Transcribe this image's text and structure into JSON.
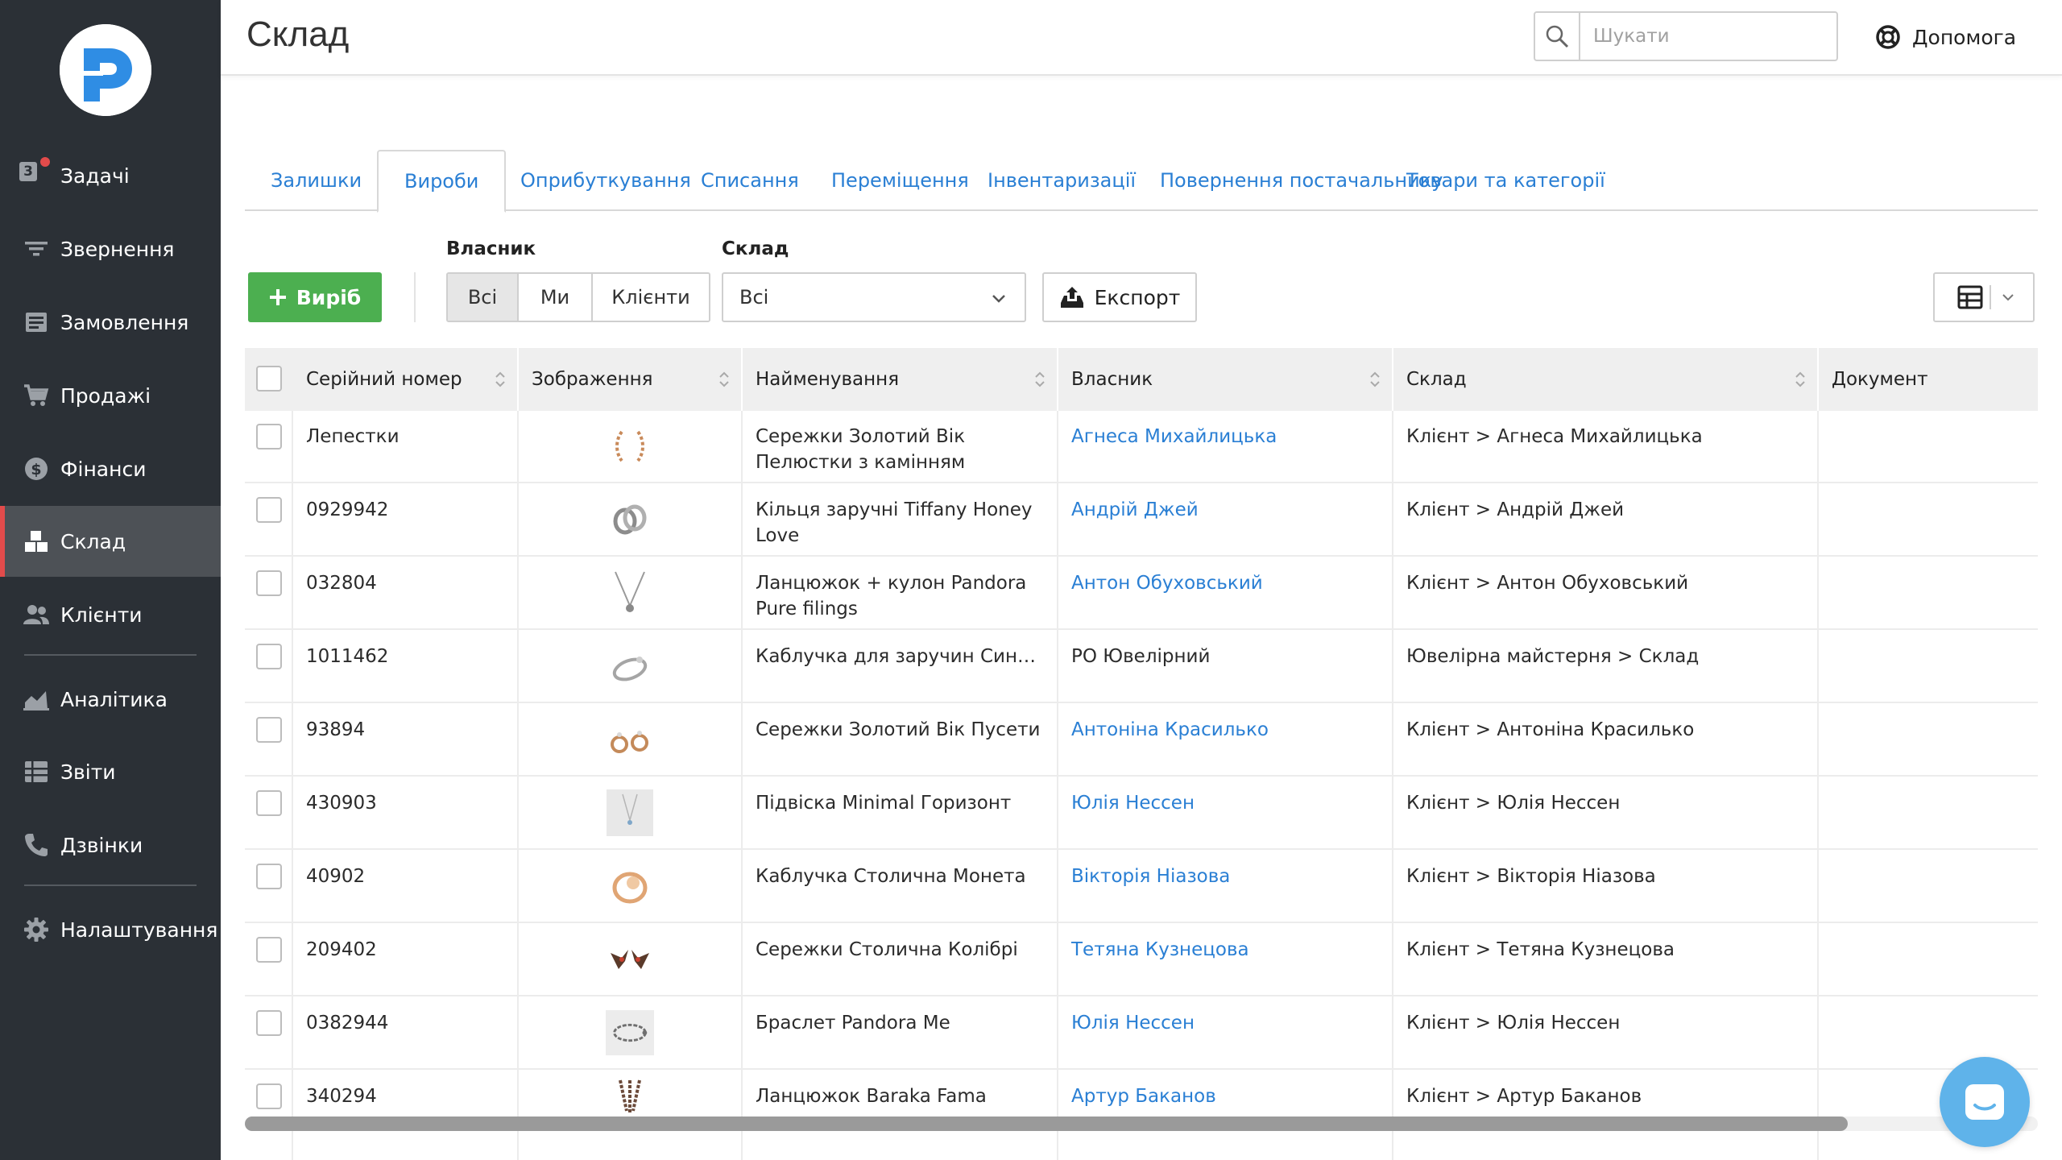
{
  "app": {
    "title": "Склад"
  },
  "sidebar": {
    "task_badge": "3",
    "items": [
      {
        "label": "Задачі"
      },
      {
        "label": "Звернення"
      },
      {
        "label": "Замовлення"
      },
      {
        "label": "Продажі"
      },
      {
        "label": "Фінанси"
      },
      {
        "label": "Склад"
      },
      {
        "label": "Клієнти"
      },
      {
        "label": "Аналітика"
      },
      {
        "label": "Звіти"
      },
      {
        "label": "Дзвінки"
      },
      {
        "label": "Налаштування"
      }
    ]
  },
  "header": {
    "search_placeholder": "Шукати",
    "help_label": "Допомога"
  },
  "tabs": [
    {
      "label": "Залишки"
    },
    {
      "label": "Вироби"
    },
    {
      "label": "Оприбуткування"
    },
    {
      "label": "Списання"
    },
    {
      "label": "Переміщення"
    },
    {
      "label": "Інвентаризації"
    },
    {
      "label": "Повернення постачальнику"
    },
    {
      "label": "Товари та категорії"
    }
  ],
  "toolbar": {
    "add_label": "Виріб",
    "owner_label": "Власник",
    "owner_options": [
      "Всі",
      "Ми",
      "Клієнти"
    ],
    "warehouse_label": "Склад",
    "warehouse_value": "Всі",
    "export_label": "Експорт"
  },
  "table": {
    "columns": [
      "Серійний номер",
      "Зображення",
      "Найменування",
      "Власник",
      "Склад",
      "Документ"
    ],
    "rows": [
      {
        "serial": "Лепестки",
        "name": "Сережки Золотий Вік Пелюстки з камінням",
        "owner": "Агнеса Михайлицька",
        "warehouse": "Клієнт > Агнеса Михайлицька",
        "document": ""
      },
      {
        "serial": "0929942",
        "name": "Кільця заручні Tiffany Honey Love",
        "owner": "Андрій Джей",
        "warehouse": "Клієнт > Андрій Джей",
        "document": ""
      },
      {
        "serial": "032804",
        "name": "Ланцюжок + кулон Pandora Pure filings",
        "owner": "Антон Обуховський",
        "warehouse": "Клієнт > Антон Обуховський",
        "document": ""
      },
      {
        "serial": "1011462",
        "name": "Каблучка для заручин Синевир l...",
        "owner": "PO Ювелірний",
        "warehouse": "Ювелірна майстерня > Склад",
        "document": ""
      },
      {
        "serial": "93894",
        "name": "Сережки Золотий Вік Пусети",
        "owner": "Антоніна Красилько",
        "warehouse": "Клієнт > Антоніна Красилько",
        "document": ""
      },
      {
        "serial": "430903",
        "name": "Підвіска Minimal Горизонт",
        "owner": "Юлія Нессен",
        "warehouse": "Клієнт > Юлія Нессен",
        "document": ""
      },
      {
        "serial": "40902",
        "name": "Каблучка Столична Монета",
        "owner": "Вікторія Ніазова",
        "warehouse": "Клієнт > Вікторія Ніазова",
        "document": ""
      },
      {
        "serial": "209402",
        "name": "Сережки Столична Колібрі",
        "owner": "Тетяна Кузнецова",
        "warehouse": "Клієнт > Тетяна Кузнецова",
        "document": ""
      },
      {
        "serial": "0382944",
        "name": "Браслет Pandora Me",
        "owner": "Юлія Нессен",
        "warehouse": "Клієнт > Юлія Нессен",
        "document": ""
      },
      {
        "serial": "340294",
        "name": "Ланцюжок Baraka Fama",
        "owner": "Артур Баканов",
        "warehouse": "Клієнт > Артур Баканов",
        "document": ""
      }
    ]
  },
  "colors": {
    "sidebar_bg": "#2b3036",
    "sidebar_active": "#4d5156",
    "accent_red": "#e24b4b",
    "link_blue": "#2a7fd4",
    "add_green": "#4caf50",
    "chat_blue": "#5fb3ea"
  }
}
